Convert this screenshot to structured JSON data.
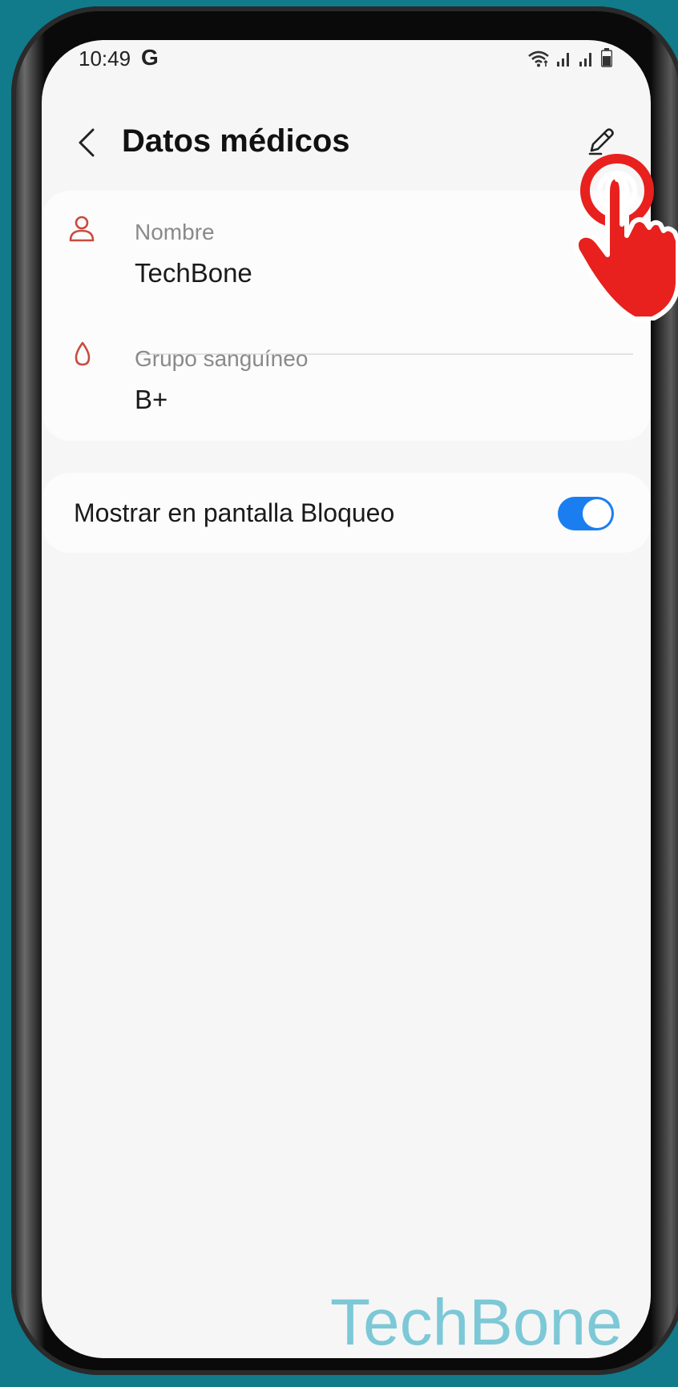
{
  "status_bar": {
    "time": "10:49",
    "g_badge": "G",
    "icons": [
      "wifi-icon",
      "signal-icon",
      "signal-icon",
      "battery-icon"
    ]
  },
  "header": {
    "title": "Datos médicos",
    "back_icon": "chevron-left-icon",
    "edit_icon": "pencil-icon"
  },
  "medical_info": {
    "name": {
      "icon": "person-icon",
      "label": "Nombre",
      "value": "TechBone"
    },
    "blood_type": {
      "icon": "blood-drop-icon",
      "label": "Grupo sanguíneo",
      "value": "B+"
    }
  },
  "lock_screen": {
    "label": "Mostrar en pantalla Bloqueo",
    "enabled": true
  },
  "watermark": "TechBone",
  "colors": {
    "background": "#117a8b",
    "screen": "#f6f6f6",
    "card": "#fcfcfc",
    "accent_icon": "#c94a3e",
    "toggle_on": "#1a7ef0",
    "tap_hand": "#e8211e",
    "watermark": "#7dc8d6"
  }
}
